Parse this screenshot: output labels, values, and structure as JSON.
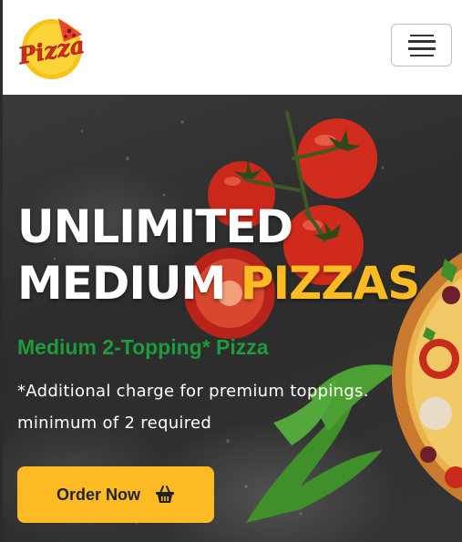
{
  "header": {
    "logo_text": "Pizza",
    "menu_icon": "hamburger-menu-icon"
  },
  "hero": {
    "headline_line1": "UNLIMITED",
    "headline_line2_white": "MEDIUM",
    "headline_line2_accent": "PIZZAS",
    "subheading": "Medium 2-Topping* Pizza",
    "note": "*Additional charge for premium toppings. minimum of 2 required",
    "cta_label": "Order Now",
    "cta_icon": "shopping-basket-icon"
  },
  "colors": {
    "accent": "#fcbb22",
    "green": "#1e9b3c",
    "dark_bg": "#2f2f2f"
  }
}
